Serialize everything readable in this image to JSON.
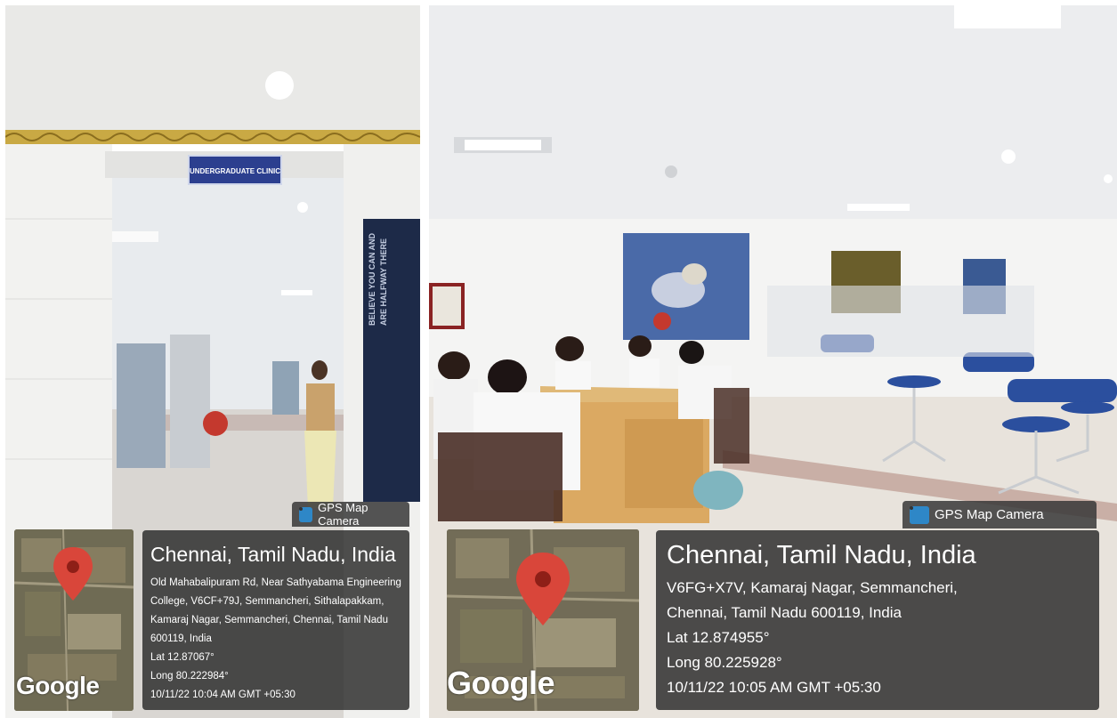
{
  "left_photo": {
    "sign_text": "UNDERGRADUATE CLINIC",
    "poster_text": "BELIEVE YOU CAN AND ARE HALFWAY THERE",
    "badge": "GPS Map Camera",
    "map_logo": "Google",
    "city": "Chennai, Tamil Nadu, India",
    "address_lines": [
      "Old Mahabalipuram Rd, Near Sathyabama Engineering",
      "College, V6CF+79J, Semmancheri, Sithalapakkam,",
      "Kamaraj Nagar, Semmancheri, Chennai, Tamil Nadu",
      "600119, India"
    ],
    "lat": "Lat 12.87067°",
    "long": "Long 80.222984°",
    "datetime": "10/11/22 10:04 AM GMT +05:30"
  },
  "right_photo": {
    "badge": "GPS Map Camera",
    "map_logo": "Google",
    "city": "Chennai, Tamil Nadu, India",
    "address_lines": [
      "V6FG+X7V, Kamaraj Nagar, Semmancheri,",
      "Chennai, Tamil Nadu 600119, India"
    ],
    "lat": "Lat 12.874955°",
    "long": "Long 80.225928°",
    "datetime": "10/11/22 10:05 AM GMT +05:30"
  },
  "icons": {
    "location_pin": "map-pin-icon",
    "camera": "gps-camera-icon"
  },
  "colors": {
    "pin": "#d9463a",
    "overlay": "#2b2b2b",
    "sign_blue": "#2c3f8f"
  }
}
